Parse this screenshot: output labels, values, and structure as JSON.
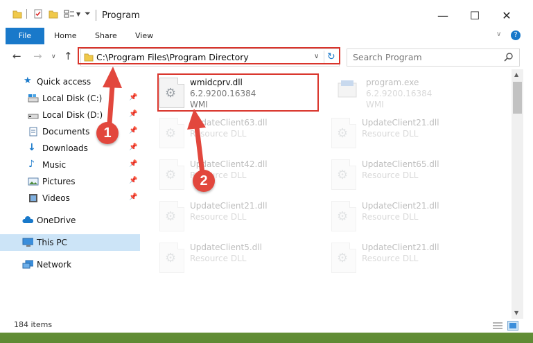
{
  "window": {
    "title": "Program"
  },
  "ribbon": {
    "file": "File",
    "home": "Home",
    "share": "Share",
    "view": "View"
  },
  "address": {
    "path": "C:\\Program Files\\Program Directory"
  },
  "search": {
    "placeholder": "Search Program"
  },
  "sidebar": {
    "items": [
      {
        "label": "Quick access",
        "icon": "star-icon"
      },
      {
        "label": "Local Disk (C:)",
        "icon": "drive-icon",
        "pinned": true
      },
      {
        "label": "Local Disk (D:)",
        "icon": "drive-icon",
        "pinned": true
      },
      {
        "label": "Documents",
        "icon": "documents-icon",
        "pinned": true
      },
      {
        "label": "Downloads",
        "icon": "download-icon",
        "pinned": true
      },
      {
        "label": "Music",
        "icon": "music-icon",
        "pinned": true
      },
      {
        "label": "Pictures",
        "icon": "pictures-icon",
        "pinned": true
      },
      {
        "label": "Videos",
        "icon": "videos-icon",
        "pinned": true
      },
      {
        "label": "OneDrive",
        "icon": "onedrive-icon"
      },
      {
        "label": "This PC",
        "icon": "pc-icon",
        "selected": true
      },
      {
        "label": "Network",
        "icon": "network-icon"
      }
    ]
  },
  "files": [
    {
      "name": "wmidcprv.dll",
      "version": "6.2.9200.16384",
      "desc": "WMI"
    },
    {
      "name": "program.exe",
      "version": "6.2.9200.16384",
      "desc": "WMI"
    },
    {
      "name": "UpdateClient63.dll",
      "desc": "Resource DLL"
    },
    {
      "name": "UpdateClient21.dll",
      "desc": "Resource DLL"
    },
    {
      "name": "UpdateClient42.dll",
      "desc": "Resource DLL"
    },
    {
      "name": "UpdateClient65.dll",
      "desc": "Resource DLL"
    },
    {
      "name": "UpdateClient21.dll",
      "desc": "Resource DLL"
    },
    {
      "name": "UpdateClient21.dll",
      "desc": "Resource DLL"
    },
    {
      "name": "UpdateClient5.dll",
      "desc": "Resource DLL"
    },
    {
      "name": "UpdateClient21.dll",
      "desc": "Resource DLL"
    }
  ],
  "status": {
    "count": "184 items"
  },
  "callouts": {
    "one": "1",
    "two": "2"
  },
  "colors": {
    "accent": "#1979ca",
    "highlight": "#d9342b",
    "selected": "#cce4f7"
  }
}
